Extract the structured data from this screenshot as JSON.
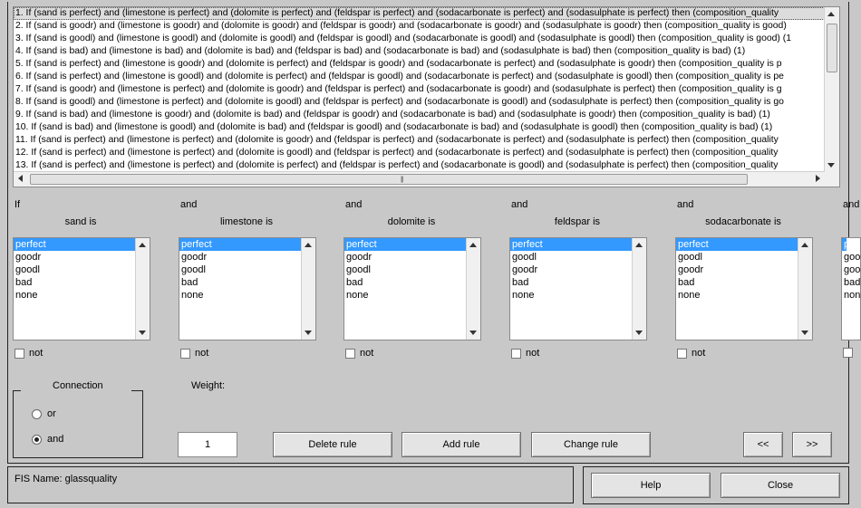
{
  "rules": [
    "1. If (sand is perfect) and (limestone is perfect) and (dolomite is perfect) and (feldspar is perfect) and (sodacarbonate is perfect) and (sodasulphate is perfect) then (composition_quality",
    "2. If (sand is goodr) and (limestone is goodr) and (dolomite is goodr) and (feldspar is goodr) and (sodacarbonate is goodr) and (sodasulphate is goodr) then (composition_quality is good)",
    "3. If (sand is goodl) and (limestone is goodl) and (dolomite is goodl) and (feldspar is goodl) and (sodacarbonate is goodl) and (sodasulphate is goodl) then (composition_quality is good) (1",
    "4. If (sand is bad) and (limestone is bad) and (dolomite is bad) and (feldspar is bad) and (sodacarbonate is bad) and (sodasulphate is bad) then (composition_quality is bad) (1)",
    "5. If (sand is perfect) and (limestone is goodr) and (dolomite is perfect) and (feldspar is goodr) and (sodacarbonate is perfect) and (sodasulphate is goodr) then (composition_quality is p",
    "6. If (sand is perfect) and (limestone is goodl) and (dolomite is perfect) and (feldspar is goodl) and (sodacarbonate is perfect) and (sodasulphate is goodl) then (composition_quality is pe",
    "7. If (sand is goodr) and (limestone is perfect) and (dolomite is goodr) and (feldspar is perfect) and (sodacarbonate is goodr) and (sodasulphate is perfect) then (composition_quality is g",
    "8. If (sand is goodl) and (limestone is perfect) and (dolomite is goodl) and (feldspar is perfect) and (sodacarbonate is goodl) and (sodasulphate is perfect) then (composition_quality is go",
    "9. If (sand is bad) and (limestone is goodr) and (dolomite is bad) and (feldspar is goodr) and (sodacarbonate is bad) and (sodasulphate is goodr) then (composition_quality is bad) (1)",
    "10. If (sand is bad) and (limestone is goodl) and (dolomite is bad) and (feldspar is goodl) and (sodacarbonate is bad) and (sodasulphate is goodl) then (composition_quality is bad) (1)",
    "11. If (sand is perfect) and (limestone is perfect) and (dolomite is goodr) and (feldspar is perfect) and (sodacarbonate is perfect) and (sodasulphate is perfect) then (composition_quality",
    "12. If (sand is perfect) and (limestone is perfect) and (dolomite is goodl) and (feldspar is perfect) and (sodacarbonate is perfect) and (sodasulphate is perfect) then (composition_quality",
    "13. If (sand is perfect) and (limestone is perfect) and (dolomite is perfect) and (feldspar is perfect) and (sodacarbonate is goodl) and (sodasulphate is perfect) then (composition_quality"
  ],
  "rules_scroll_grip": "|||",
  "variables": [
    {
      "connector": "If",
      "title": "sand is",
      "options": [
        "perfect",
        "goodr",
        "goodl",
        "bad",
        "none"
      ],
      "not_label": "not"
    },
    {
      "connector": "and",
      "title": "limestone is",
      "options": [
        "perfect",
        "goodr",
        "goodl",
        "bad",
        "none"
      ],
      "not_label": "not"
    },
    {
      "connector": "and",
      "title": "dolomite is",
      "options": [
        "perfect",
        "goodr",
        "goodl",
        "bad",
        "none"
      ],
      "not_label": "not"
    },
    {
      "connector": "and",
      "title": "feldspar is",
      "options": [
        "perfect",
        "goodl",
        "goodr",
        "bad",
        "none"
      ],
      "not_label": "not"
    },
    {
      "connector": "and",
      "title": "sodacarbonate is",
      "options": [
        "perfect",
        "goodl",
        "goodr",
        "bad",
        "none"
      ],
      "not_label": "not"
    },
    {
      "connector": "and",
      "title": "",
      "options": [
        "per",
        "goo",
        "goo",
        "bad",
        "non"
      ],
      "not_label": ""
    }
  ],
  "connection": {
    "title": "Connection",
    "or_label": "or",
    "and_label": "and",
    "selected": "and"
  },
  "weight": {
    "label": "Weight:",
    "value": "1"
  },
  "buttons": {
    "delete_rule": "Delete rule",
    "add_rule": "Add rule",
    "change_rule": "Change rule",
    "prev": "<<",
    "next": ">>",
    "help": "Help",
    "close": "Close"
  },
  "status": {
    "fis_name": "FIS Name: glassquality"
  }
}
